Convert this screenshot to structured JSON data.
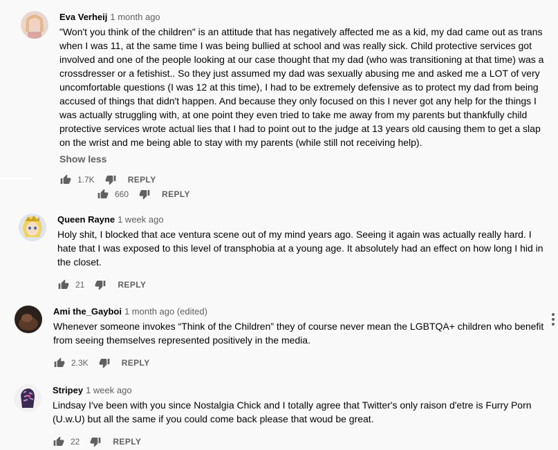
{
  "comments": [
    {
      "author": "Eva Verheij",
      "time": "1 month ago",
      "text": "\"Won't you think of the children\" is an attitude that has negatively affected me as a kid, my dad came out as trans when I was 11, at the same time I was being bullied at school and was really sick. Child protective services got involved and one of the people looking at our case thought that my dad (who was transitioning at that time) was a crossdresser or a fetishist.. So they just assumed my dad was sexually abusing me and asked me a LOT of very uncomfortable questions (I was 12 at this time), I had to be extremely defensive as to protect my dad from being accused of things that didn't happen. And because they only focused on this I never got any help for the things I was actually struggling with, at one point they even tried to take me away from my parents but thankfully child protective services wrote actual lies that I had to point out to the judge at 13 years old causing them to get a slap on the wrist and me being able to stay with my parents (while still not receiving help).",
      "show_less": "Show less",
      "likes": "1.7K",
      "reply_label": "REPLY"
    },
    {
      "likes": "660",
      "reply_label": "REPLY"
    },
    {
      "author": "Queen Rayne",
      "time": "1 week ago",
      "text": "Holy shit, I blocked that ace ventura scene out of my mind years ago. Seeing it again was actually really hard. I hate that I was exposed to this level of transphobia at a young age. It absolutely had an effect on how long I hid in the closet.",
      "likes": "21",
      "reply_label": "REPLY"
    },
    {
      "author": "Ami the_Gayboi",
      "time": "1 month ago (edited)",
      "text": "Whenever someone invokes “Think of the Children” they of course never mean the LGBTQA+ children who benefit from seeing themselves represented positively in the media.",
      "likes": "2.3K",
      "reply_label": "REPLY"
    },
    {
      "author": "Stripey",
      "time": "1 week ago",
      "text": "Lindsay I've been with you since Nostalgia Chick and I totally agree that Twitter's only raison d'etre is Furry Porn (U.w.U) but all the same if you could come back please that woud be great.",
      "likes": "22",
      "reply_label": "REPLY"
    }
  ],
  "icons": {
    "like": "thumbs-up-icon",
    "dislike": "thumbs-down-icon",
    "more": "more-vertical-icon"
  },
  "colors": {
    "background": "#f9f9f9",
    "text": "#030303",
    "secondary": "#606060"
  }
}
